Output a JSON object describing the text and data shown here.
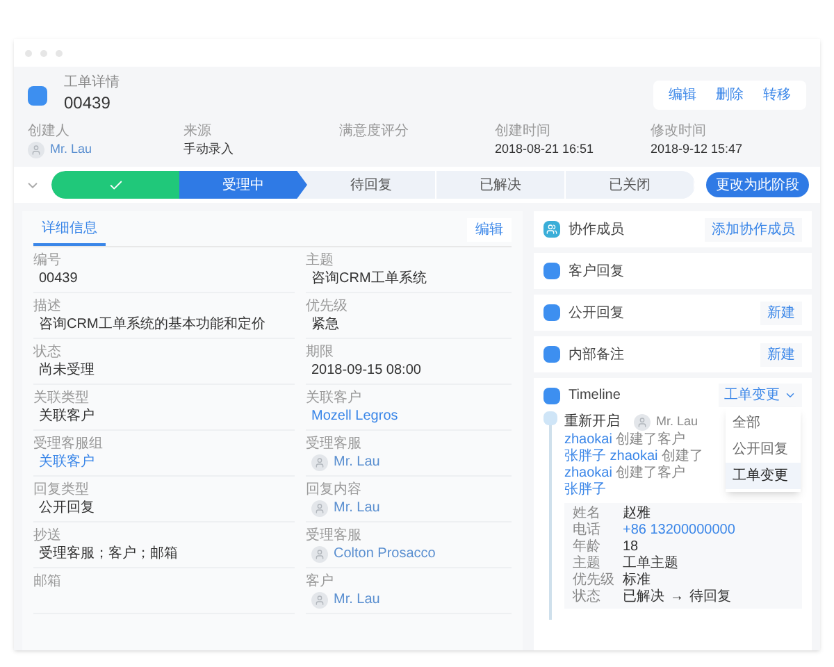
{
  "header": {
    "subtitle": "工单详情",
    "number": "00439",
    "actions": [
      "编辑",
      "删除",
      "转移"
    ]
  },
  "meta": [
    {
      "label": "创建人",
      "value": "Mr. Lau",
      "kind": "user"
    },
    {
      "label": "来源",
      "value": "手动录入",
      "kind": "text"
    },
    {
      "label": "满意度评分"
    },
    {
      "label": "创建时间",
      "value": "2018-08-21 16:51",
      "kind": "text"
    },
    {
      "label": "修改时间",
      "value": "2018-9-12 15:47",
      "kind": "text"
    }
  ],
  "stages": [
    {
      "done": true,
      "selected": false
    },
    {
      "label": "受理中",
      "done": false,
      "selected": true
    },
    {
      "label": "待回复",
      "done": false,
      "selected": false
    },
    {
      "label": "已解决",
      "done": false,
      "selected": false
    },
    {
      "label": "已关闭",
      "done": false,
      "selected": false
    }
  ],
  "stage_button": "更改为此阶段",
  "details": {
    "tab": "详细信息",
    "edit": "编辑",
    "fields": [
      {
        "label": "编号",
        "value": "00439",
        "kind": "text"
      },
      {
        "label": "主题",
        "value": "咨询CRM工单系统",
        "kind": "text"
      },
      {
        "label": "描述",
        "value": "咨询CRM工单系统的基本功能和定价",
        "kind": "text"
      },
      {
        "label": "优先级",
        "value": "紧急",
        "kind": "text"
      },
      {
        "label": "状态",
        "value": "尚未受理",
        "kind": "text"
      },
      {
        "label": "期限",
        "value": "2018-09-15 08:00",
        "kind": "text"
      },
      {
        "label": "关联类型",
        "value": "关联客户",
        "kind": "text"
      },
      {
        "label": "关联客户",
        "value": "Mozell Legros",
        "kind": "link"
      },
      {
        "label": "受理客服组",
        "value": "关联客户",
        "kind": "link"
      },
      {
        "label": "受理客服",
        "value": "Mr. Lau",
        "kind": "user"
      },
      {
        "label": "回复类型",
        "value": "公开回复",
        "kind": "text"
      },
      {
        "label": "回复内容",
        "value": "Mr. Lau",
        "kind": "user"
      },
      {
        "label": "抄送",
        "value": "受理客服；客户；邮箱",
        "kind": "text"
      },
      {
        "label": "受理客服",
        "value": "Colton Prosacco",
        "kind": "user"
      },
      {
        "label": "邮箱"
      },
      {
        "label": "客户",
        "value": "Mr. Lau",
        "kind": "user"
      }
    ]
  },
  "side_cards": [
    {
      "title": "协作成员",
      "kind": "members",
      "button": "添加协作成员"
    },
    {
      "title": "客户回复",
      "kind": "plain"
    },
    {
      "title": "公开回复",
      "kind": "plain",
      "button": "新建"
    },
    {
      "title": "内部备注",
      "kind": "plain",
      "button": "新建"
    }
  ],
  "timeline": {
    "title": "Timeline",
    "filter": "工单变更",
    "menu": [
      {
        "label": "全部",
        "selected": false
      },
      {
        "label": "公开回复",
        "selected": false
      },
      {
        "label": "工单变更",
        "selected": true
      }
    ],
    "entry": {
      "title": "重新开启",
      "user": "Mr. Lau",
      "lines": [
        [
          {
            "kind": "link",
            "text": "zhaokai"
          },
          {
            "kind": "text",
            "text": " 创建了客户 "
          },
          {
            "kind": "link",
            "text": "张胖子"
          },
          {
            "kind": "link",
            "text": " zhaokai"
          },
          {
            "kind": "text",
            "text": " 创建了"
          }
        ],
        [
          {
            "kind": "link",
            "text": "zhaokai"
          },
          {
            "kind": "text",
            "text": " 创建了客户 "
          },
          {
            "kind": "link",
            "text": "张胖子"
          }
        ]
      ],
      "rows": [
        {
          "label": "姓名",
          "value": "赵雅",
          "kind": "text"
        },
        {
          "label": "电话",
          "value": "+86 13200000000",
          "kind": "link"
        },
        {
          "label": "年龄",
          "value": "18",
          "kind": "text"
        },
        {
          "label": "主题",
          "value": "工单主题",
          "kind": "text"
        },
        {
          "label": "优先级",
          "value": "标准",
          "kind": "text"
        },
        {
          "label": "状态",
          "value": "已解决",
          "arrow": "→",
          "to": "待回复",
          "kind": "change"
        }
      ]
    }
  }
}
